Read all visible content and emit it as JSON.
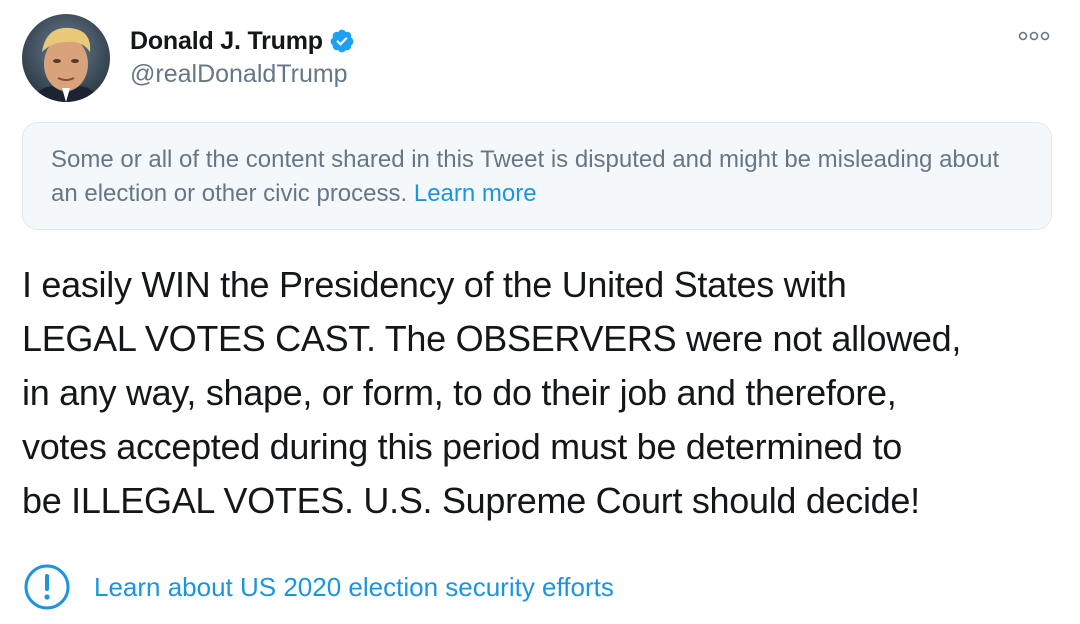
{
  "author": {
    "name": "Donald J. Trump",
    "handle": "@realDonaldTrump"
  },
  "notice": {
    "text": "Some or all of the content shared in this Tweet is disputed and might be misleading about an election or other civic process.",
    "link_label": "Learn more"
  },
  "tweet": {
    "lines": [
      "I easily WIN the Presidency of the United States with",
      "LEGAL VOTES CAST. The OBSERVERS were not allowed,",
      "in any way, shape, or form, to do their job and therefore,",
      "votes accepted during this period must be determined to",
      "be ILLEGAL VOTES. U.S. Supreme Court should decide!"
    ]
  },
  "learn_link": {
    "label": "Learn about US 2020 election security efforts",
    "icon": "exclamation-circle-icon"
  },
  "colors": {
    "accent": "#1b95e0",
    "muted": "#657786",
    "notice_bg": "#f5f8fa",
    "verified": "#1da1f2"
  }
}
